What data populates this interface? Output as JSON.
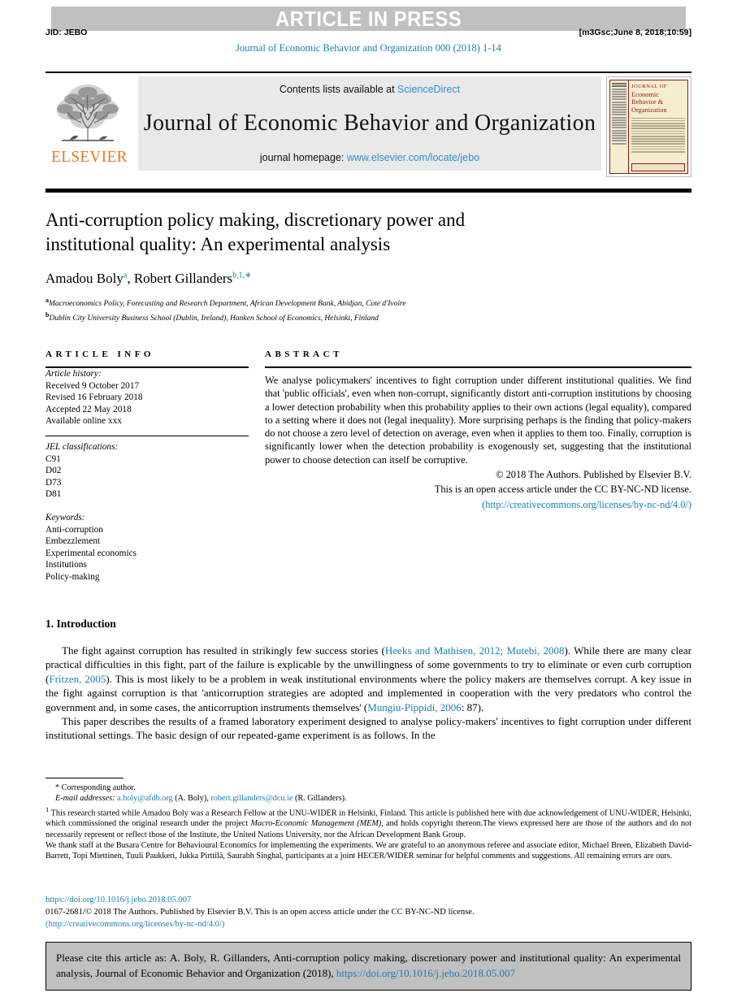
{
  "header": {
    "banner_text": "ARTICLE IN PRESS",
    "jid": "JID: JEBO",
    "stamp": "[m3Gsc;June 8, 2018;10:59]",
    "journal_ref": "Journal of Economic Behavior and Organization 000 (2018) 1-14"
  },
  "masthead": {
    "contents_prefix": "Contents lists available at ",
    "contents_link": "ScienceDirect",
    "journal_title": "Journal of Economic Behavior and Organization",
    "homepage_prefix": "journal homepage: ",
    "homepage_link": "www.elsevier.com/locate/jebo",
    "publisher_wordmark": "ELSEVIER",
    "cover": {
      "line1": "JOURNAL OF",
      "line2": "Economic",
      "line3": "Behavior &",
      "line4": "Organization"
    }
  },
  "article": {
    "title_line1": "Anti-corruption policy making, discretionary power and",
    "title_line2": "institutional quality: An experimental analysis",
    "author1": "Amadou Boly",
    "author1_sup": "a",
    "author2": "Robert Gillanders",
    "author2_sup": "b,1,",
    "affiliation_a_marker": "a",
    "affiliation_a": "Macroeconomics Policy, Forecasting and Research Department, African Development Bank, Abidjan, Cote d'Ivoire",
    "affiliation_b_marker": "b",
    "affiliation_b": "Dublin City University Business School (Dublin, Ireland), Hanken School of Economics, Helsinki, Finland"
  },
  "article_info": {
    "heading": "ARTICLE INFO",
    "history_label": "Article history:",
    "history": [
      "Received 9 October 2017",
      "Revised 16 February 2018",
      "Accepted 22 May 2018",
      "Available online xxx"
    ],
    "jel_label": "JEL classifications:",
    "jel": [
      "C91",
      "D02",
      "D73",
      "D81"
    ],
    "keywords_label": "Keywords:",
    "keywords": [
      "Anti-corruption",
      "Embezzlement",
      "Experimental economics",
      "Institutions",
      "Policy-making"
    ]
  },
  "abstract": {
    "heading": "ABSTRACT",
    "text": "We analyse policymakers' incentives to fight corruption under different institutional qualities. We find that 'public officials', even when non-corrupt, significantly distort anti-corruption institutions by choosing a lower detection probability when this probability applies to their own actions (legal equality), compared to a setting where it does not (legal inequality). More surprising perhaps is the finding that policy-makers do not choose a zero level of detection on average, even when it applies to them too. Finally, corruption is significantly lower when the detection probability is exogenously set, suggesting that the institutional power to choose detection can itself be corruptive.",
    "copyright_line": "© 2018 The Authors. Published by Elsevier B.V.",
    "license_line": "This is an open access article under the CC BY-NC-ND license.",
    "license_url": "(http://creativecommons.org/licenses/by-nc-nd/4.0/)"
  },
  "body": {
    "section_heading": "1. Introduction",
    "para1_a": "The fight against corruption has resulted in strikingly few success stories (",
    "para1_cite1": "Heeks and Mathisen, 2012; Mutebi, 2008",
    "para1_b": "). While there are many clear practical difficulties in this fight, part of the failure is explicable by the unwillingness of some governments to try to eliminate or even curb corruption (",
    "para1_cite2": "Fritzen, 2005",
    "para1_c": "). This is most likely to be a problem in weak institutional environments where the policy makers are themselves corrupt. A key issue in the fight against corruption is that 'anticorruption strategies are adopted and implemented in cooperation with the very predators who control the government and, in some cases, the anticorruption instruments themselves' (",
    "para1_cite3": "Mungiu-Pippidi, 2006",
    "para1_d": ": 87).",
    "para2": "This paper describes the results of a framed laboratory experiment designed to analyse policy-makers' incentives to fight corruption under different institutional settings. The basic design of our repeated-game experiment is as follows. In the"
  },
  "footnotes": {
    "corresponding_marker": "*",
    "corresponding": "Corresponding author.",
    "email_label": "E-mail addresses:",
    "email1": "a.boly@afdb.org",
    "email1_name": "(A. Boly),",
    "email2": "robert.gillanders@dcu.ie",
    "email2_name": "(R. Gillanders).",
    "fn1_marker": "1",
    "fn1_a": "This research started while Amadou Boly was a Research Fellow at the UNU-WIDER in Helsinki, Finland. This article is published here with due acknowledgement of UNU-WIDER, Helsinki, which commissioned the original research under the project ",
    "fn1_italic": "Macro-Economic Management (MEM)",
    "fn1_b": ", and holds copyright thereon.The views expressed here are those of the authors and do not necessarily represent or reflect those of the Institute, the United Nations University, nor the African Development Bank Group.",
    "fn2": "We thank staff at the Busara Centre for Behavioural Economics for implementing the experiments. We are grateful to an anonymous referee and associate editor, Michael Breen, Elizabeth David-Barrett, Topi Miettinen, Tuuli Paukkeri, Jukka Pirttilä, Saurabh Singhal, participants at a joint HECER/WIDER seminar for helpful comments and suggestions. All remaining errors are ours."
  },
  "doi_block": {
    "doi_url": "https://doi.org/10.1016/j.jebo.2018.05.007",
    "issn_line": "0167-2681/© 2018 The Authors. Published by Elsevier B.V. This is an open access article under the CC BY-NC-ND license.",
    "license_url": "(http://creativecommons.org/licenses/by-nc-nd/4.0/)"
  },
  "cite_box": {
    "text": "Please cite this article as: A. Boly, R. Gillanders, Anti-corruption policy making, discretionary power and institutional quality: An experimental analysis, Journal of Economic Behavior and Organization (2018),",
    "link": "https://doi.org/10.1016/j.jebo.2018.05.007"
  },
  "colors": {
    "link": "#1a7db5",
    "banner_bg": "#c0c0c0",
    "masthead_bg": "#e9e9e9",
    "elsevier_orange": "#e87722",
    "cover_red": "#8d1b1b",
    "cover_cream": "#f6edcf"
  }
}
